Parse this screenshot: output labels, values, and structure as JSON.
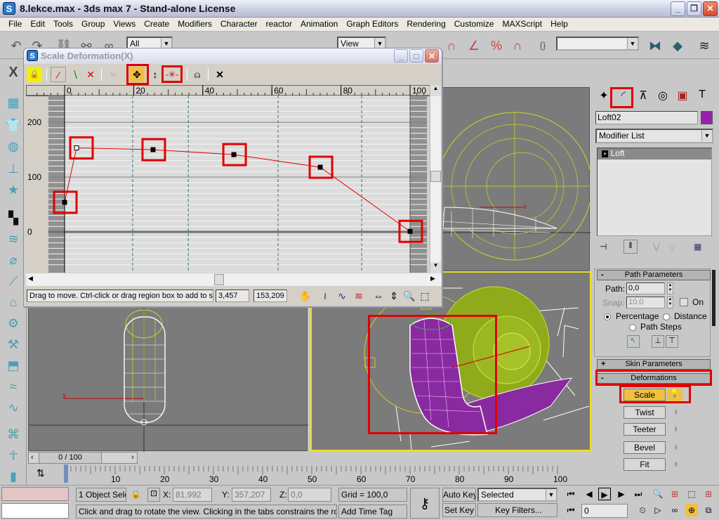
{
  "window": {
    "title": "8.lekce.max - 3ds max 7  - Stand-alone License",
    "app_icon": "3ds-max-logo-icon",
    "controls": [
      "minimize",
      "restore",
      "close"
    ]
  },
  "menubar": {
    "items": [
      "File",
      "Edit",
      "Tools",
      "Group",
      "Views",
      "Create",
      "Modifiers",
      "Character",
      "reactor",
      "Animation",
      "Graph Editors",
      "Rendering",
      "Customize",
      "MAXScript",
      "Help"
    ]
  },
  "toolbar": {
    "selection_filter": "All",
    "ref_coord": "View",
    "named_selection": ""
  },
  "dialog": {
    "title": "Scale Deformation(X)",
    "toolbar_icons": [
      "make-symmetrical-icon",
      "display-x-axis-icon",
      "display-y-axis-icon",
      "display-xy-axes-icon",
      "swap-curves-icon",
      "move-control-point-icon",
      "scale-control-point-icon",
      "insert-corner-point-icon",
      "delete-control-point-icon",
      "reset-curve-icon"
    ],
    "highlighted_tools": [
      "move-control-point-icon",
      "insert-corner-point-icon"
    ],
    "graph": {
      "x_ticks": [
        "0",
        "20",
        "40",
        "60",
        "80",
        "100"
      ],
      "y_ticks": [
        "200",
        "100",
        "0"
      ],
      "curve_color": "#e00000",
      "points": [
        {
          "x": 0,
          "y": 54
        },
        {
          "x": 3.457,
          "y": 153.209,
          "selected": true
        },
        {
          "x": 25.6,
          "y": 150
        },
        {
          "x": 49,
          "y": 141
        },
        {
          "x": 74,
          "y": 118
        },
        {
          "x": 100,
          "y": 1
        }
      ]
    },
    "status_text": "Drag to move. Ctrl-click or drag region box to add to sel",
    "x_value": "3,457",
    "y_value": "153,209",
    "nav_icons": [
      "pan-icon",
      "zoom-extents-icon",
      "zoom-horizontal-extents-icon",
      "zoom-vertical-extents-icon",
      "zoom-horizontal-icon",
      "zoom-vertical-icon",
      "zoom-icon",
      "zoom-region-icon"
    ]
  },
  "command_panel": {
    "tabs": [
      "create",
      "modify",
      "hierarchy",
      "motion",
      "display",
      "utilities"
    ],
    "active_tab": "modify",
    "object_name": "Loft02",
    "object_color": "#9a1fb0",
    "modifier_list": "Modifier List",
    "stack_item": "Loft",
    "path_parameters": {
      "header": "Path Parameters",
      "path_label": "Path:",
      "path_value": "0,0",
      "snap_label": "Snap:",
      "snap_value": "10,0",
      "on_label": "On",
      "percentage": "Percentage",
      "distance": "Distance",
      "path_steps": "Path Steps"
    },
    "skin_parameters": "Skin Parameters",
    "deformations": {
      "header": "Deformations",
      "buttons": [
        "Scale",
        "Twist",
        "Teeter",
        "Bevel",
        "Fit"
      ],
      "active": "Scale"
    }
  },
  "timeline": {
    "frame_display": "0 / 100",
    "ticks": [
      "0",
      "10",
      "20",
      "30",
      "40",
      "50",
      "60",
      "70",
      "80",
      "90",
      "100"
    ]
  },
  "statusbar": {
    "selection": "1 Object Sele",
    "x_label": "X:",
    "x": "81,992",
    "y_label": "Y:",
    "y": "357,207",
    "z_label": "Z:",
    "z": "0,0",
    "grid": "Grid = 100,0",
    "prompt": "Click and drag to rotate the view.  Clicking in the tabs constrains the rotation",
    "add_time_tag": "Add Time Tag",
    "auto_key": "Auto Key",
    "set_key": "Set Key",
    "key_mode": "Selected",
    "key_filters": "Key Filters...",
    "current_frame": "0"
  }
}
